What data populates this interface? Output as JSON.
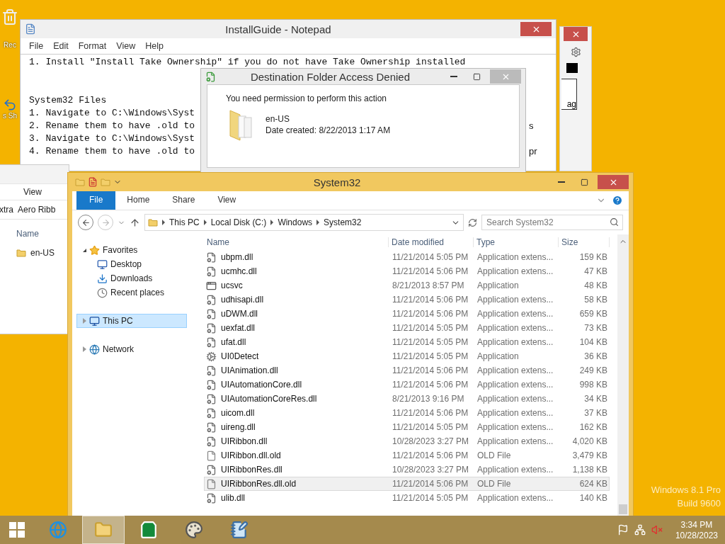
{
  "desktop": {
    "icons": [
      {
        "kind": "recycle",
        "label": "Rec"
      },
      {
        "kind": "shortcut",
        "label": "s Sh"
      }
    ]
  },
  "back_window": {
    "button": "ag"
  },
  "notepad": {
    "title": "InstallGuide - Notepad",
    "menu": [
      "File",
      "Edit",
      "Format",
      "View",
      "Help"
    ],
    "paragraphs": [
      [
        {
          "text": "1. Install \"Install Take Ownership\" if you do not have Take Ownership installed"
        }
      ],
      [
        {
          "text": "System32 Files"
        },
        {
          "text": "1. Navigate to C:\\Windows\\Syst"
        },
        {
          "text": "2. Rename them to have .old to",
          "tail": "s"
        },
        {
          "text": "3. Navigate to C:\\Windows\\Syst"
        },
        {
          "text": "4. Rename them to have .old to",
          "tail": "pr"
        }
      ]
    ]
  },
  "dialog": {
    "title": "Destination Folder Access Denied",
    "message": "You need permission to perform this action",
    "item": {
      "name": "en-US",
      "date": "Date created: 8/22/2013 1:17 AM"
    }
  },
  "back_explorer": {
    "tab": "View",
    "breadcrumb": [
      "xtra",
      "Aero Ribb"
    ],
    "column": "Name",
    "items": [
      "en-US"
    ]
  },
  "explorer": {
    "title": "System32",
    "tabs": [
      {
        "label": "File",
        "kind": "file",
        "selected": false
      },
      {
        "label": "Home",
        "kind": "tab",
        "selected": false
      },
      {
        "label": "Share",
        "kind": "tab",
        "selected": false
      },
      {
        "label": "View",
        "kind": "tab",
        "selected": false
      }
    ],
    "path": [
      "This PC",
      "Local Disk (C:)",
      "Windows",
      "System32"
    ],
    "search": {
      "placeholder": "Search System32"
    },
    "nav": [
      {
        "label": "Favorites",
        "kind": "star",
        "expanded": true,
        "selected": false,
        "children": [
          {
            "label": "Desktop",
            "kind": "desktop",
            "selected": false
          },
          {
            "label": "Downloads",
            "kind": "downloads",
            "selected": false
          },
          {
            "label": "Recent places",
            "kind": "recent",
            "selected": false
          }
        ]
      },
      {
        "label": "This PC",
        "kind": "pc",
        "expanded": false,
        "selected": true
      },
      {
        "label": "Network",
        "kind": "network",
        "expanded": false,
        "selected": false
      }
    ],
    "columns": [
      "Name",
      "Date modified",
      "Type",
      "Size"
    ],
    "files": [
      {
        "name": "ubpm.dll",
        "date": "11/21/2014 5:05 PM",
        "type": "Application extens...",
        "size": "159 KB",
        "kind": "dll",
        "selected": false
      },
      {
        "name": "ucmhc.dll",
        "date": "11/21/2014 5:06 PM",
        "type": "Application extens...",
        "size": "47 KB",
        "kind": "dll",
        "selected": false
      },
      {
        "name": "ucsvc",
        "date": "8/21/2013 8:57 PM",
        "type": "Application",
        "size": "48 KB",
        "kind": "app",
        "selected": false
      },
      {
        "name": "udhisapi.dll",
        "date": "11/21/2014 5:06 PM",
        "type": "Application extens...",
        "size": "58 KB",
        "kind": "dll",
        "selected": false
      },
      {
        "name": "uDWM.dll",
        "date": "11/21/2014 5:06 PM",
        "type": "Application extens...",
        "size": "659 KB",
        "kind": "dll",
        "selected": false
      },
      {
        "name": "uexfat.dll",
        "date": "11/21/2014 5:05 PM",
        "type": "Application extens...",
        "size": "73 KB",
        "kind": "dll",
        "selected": false
      },
      {
        "name": "ufat.dll",
        "date": "11/21/2014 5:05 PM",
        "type": "Application extens...",
        "size": "104 KB",
        "kind": "dll",
        "selected": false
      },
      {
        "name": "UI0Detect",
        "date": "11/21/2014 5:05 PM",
        "type": "Application",
        "size": "36 KB",
        "kind": "service",
        "selected": false
      },
      {
        "name": "UIAnimation.dll",
        "date": "11/21/2014 5:06 PM",
        "type": "Application extens...",
        "size": "249 KB",
        "kind": "dll",
        "selected": false
      },
      {
        "name": "UIAutomationCore.dll",
        "date": "11/21/2014 5:06 PM",
        "type": "Application extens...",
        "size": "998 KB",
        "kind": "dll",
        "selected": false
      },
      {
        "name": "UIAutomationCoreRes.dll",
        "date": "8/21/2013 9:16 PM",
        "type": "Application extens...",
        "size": "34 KB",
        "kind": "dll",
        "selected": false
      },
      {
        "name": "uicom.dll",
        "date": "11/21/2014 5:06 PM",
        "type": "Application extens...",
        "size": "37 KB",
        "kind": "dll",
        "selected": false
      },
      {
        "name": "uireng.dll",
        "date": "11/21/2014 5:05 PM",
        "type": "Application extens...",
        "size": "162 KB",
        "kind": "dll",
        "selected": false
      },
      {
        "name": "UIRibbon.dll",
        "date": "10/28/2023 3:27 PM",
        "type": "Application extens...",
        "size": "4,020 KB",
        "kind": "dll",
        "selected": false
      },
      {
        "name": "UIRibbon.dll.old",
        "date": "11/21/2014 5:06 PM",
        "type": "OLD File",
        "size": "3,479 KB",
        "kind": "blank",
        "selected": false
      },
      {
        "name": "UIRibbonRes.dll",
        "date": "10/28/2023 3:27 PM",
        "type": "Application extens...",
        "size": "1,138 KB",
        "kind": "dll",
        "selected": false
      },
      {
        "name": "UIRibbonRes.dll.old",
        "date": "11/21/2014 5:06 PM",
        "type": "OLD File",
        "size": "624 KB",
        "kind": "blank",
        "selected": true
      },
      {
        "name": "ulib.dll",
        "date": "11/21/2014 5:05 PM",
        "type": "Application extens...",
        "size": "140 KB",
        "kind": "dll",
        "selected": false
      }
    ]
  },
  "watermark": [
    "Windows 8.1 Pro",
    "Build 9600"
  ],
  "taskbar": {
    "apps": [
      {
        "kind": "ie",
        "active": false
      },
      {
        "kind": "explorer",
        "active": true
      },
      {
        "kind": "store",
        "active": false
      },
      {
        "kind": "paint",
        "active": false
      },
      {
        "kind": "notepad",
        "active": false
      }
    ],
    "tray": [
      {
        "kind": "flag"
      },
      {
        "kind": "network"
      },
      {
        "kind": "volume",
        "muted": true
      }
    ],
    "time": "3:34 PM",
    "date": "10/28/2023"
  }
}
